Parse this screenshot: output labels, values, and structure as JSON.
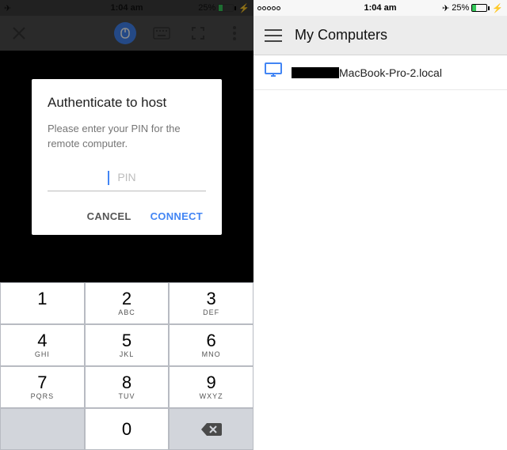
{
  "status": {
    "time": "1:04 am",
    "battery_pct": "25%",
    "airplane": "✈"
  },
  "left": {
    "dialog": {
      "title": "Authenticate to host",
      "message": "Please enter your PIN for the remote computer.",
      "placeholder": "PIN",
      "cancel": "CANCEL",
      "connect": "CONNECT"
    },
    "keypad": {
      "keys": [
        {
          "digit": "1",
          "letters": ""
        },
        {
          "digit": "2",
          "letters": "ABC"
        },
        {
          "digit": "3",
          "letters": "DEF"
        },
        {
          "digit": "4",
          "letters": "GHI"
        },
        {
          "digit": "5",
          "letters": "JKL"
        },
        {
          "digit": "6",
          "letters": "MNO"
        },
        {
          "digit": "7",
          "letters": "PQRS"
        },
        {
          "digit": "8",
          "letters": "TUV"
        },
        {
          "digit": "9",
          "letters": "WXYZ"
        },
        {
          "digit": "0",
          "letters": ""
        }
      ]
    }
  },
  "right": {
    "header_title": "My Computers",
    "computer_name_suffix": "MacBook-Pro-2.local"
  }
}
